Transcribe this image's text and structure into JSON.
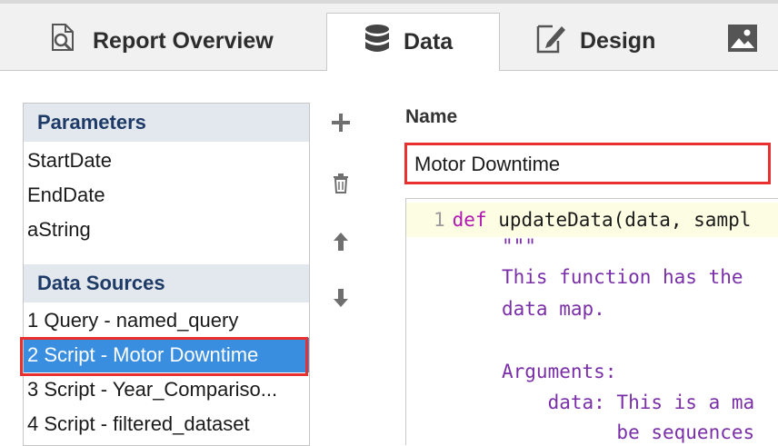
{
  "tabs": [
    {
      "label": "Report Overview",
      "icon": "search-document-icon"
    },
    {
      "label": "Data",
      "icon": "database-icon"
    },
    {
      "label": "Design",
      "icon": "edit-document-icon"
    },
    {
      "label": "",
      "icon": "image-icon"
    }
  ],
  "parameters": {
    "header": "Parameters",
    "items": [
      "StartDate",
      "EndDate",
      "aString"
    ]
  },
  "data_sources": {
    "header": "Data Sources",
    "items": [
      "1 Query - named_query",
      "2 Script - Motor Downtime",
      "3 Script - Year_Compariso...",
      "4 Script - filtered_dataset"
    ],
    "selected_index": 1
  },
  "toolbar": {
    "add_icon": "plus-icon",
    "delete_icon": "trash-icon",
    "up_icon": "arrow-up-icon",
    "down_icon": "arrow-down-icon"
  },
  "name_field": {
    "label": "Name",
    "value": "Motor Downtime"
  },
  "editor": {
    "line1_number": "1",
    "line1_keyword": "def",
    "line1_text": " updateData(data, sampl",
    "lines": [
      "\"\"\"",
      "This function has the",
      "data map.",
      "",
      "Arguments:",
      "    data: This is a ma",
      "          be sequences"
    ]
  },
  "colors": {
    "accent": "#3a8ee0",
    "highlight": "#e8312f",
    "section_header_bg": "#e2e8ee",
    "section_header_text": "#1e3a66",
    "keyword": "#b117b1"
  }
}
